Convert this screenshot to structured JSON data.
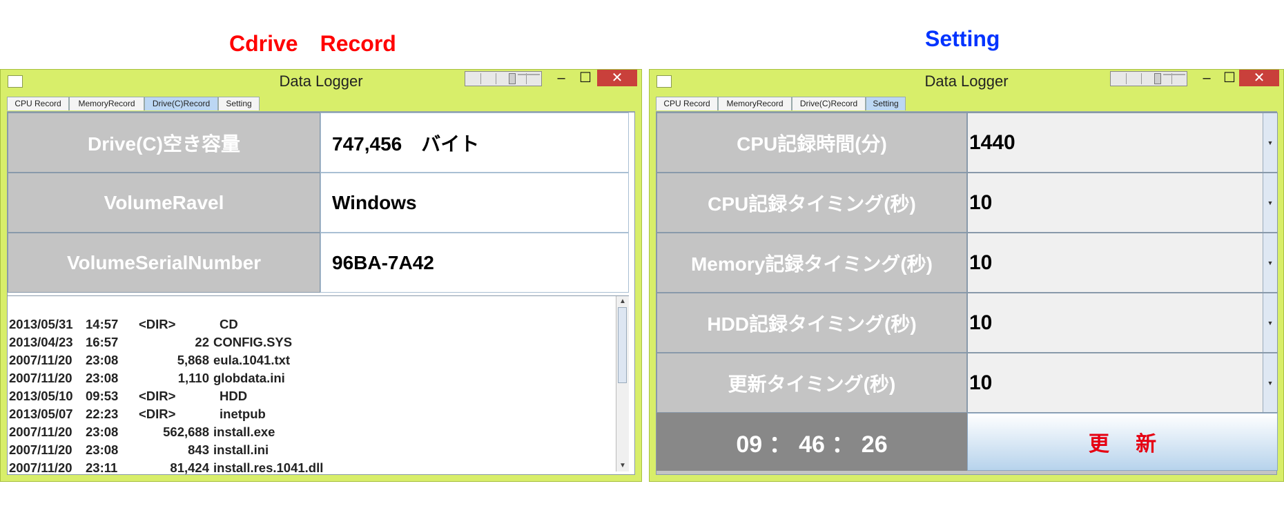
{
  "captions": {
    "left": "Cdrive　Record",
    "right": "Setting",
    "left_color": "#ff0000",
    "right_color": "#0033ff"
  },
  "window": {
    "title": "Data Logger",
    "minimize_label": "–",
    "maximize_label": "☐",
    "close_label": "✕"
  },
  "tabs": [
    "CPU Record",
    "MemoryRecord",
    "Drive(C)Record",
    "Setting"
  ],
  "drive": {
    "rows": [
      {
        "label": "Drive(C)空き容量",
        "value": "747,456　バイト"
      },
      {
        "label": "VolumeRavel",
        "value": "Windows"
      },
      {
        "label": "VolumeSerialNumber",
        "value": "96BA-7A42"
      }
    ],
    "dir_listing": [
      {
        "date": "2013/05/31",
        "time": "14:57",
        "size": "<DIR>",
        "name": "CD"
      },
      {
        "date": "2013/04/23",
        "time": "16:57",
        "size": "22",
        "name": "CONFIG.SYS"
      },
      {
        "date": "2007/11/20",
        "time": "23:08",
        "size": "5,868",
        "name": "eula.1041.txt"
      },
      {
        "date": "2007/11/20",
        "time": "23:08",
        "size": "1,110",
        "name": "globdata.ini"
      },
      {
        "date": "2013/05/10",
        "time": "09:53",
        "size": "<DIR>",
        "name": "HDD"
      },
      {
        "date": "2013/05/07",
        "time": "22:23",
        "size": "<DIR>",
        "name": "inetpub"
      },
      {
        "date": "2007/11/20",
        "time": "23:08",
        "size": "562,688",
        "name": "install.exe"
      },
      {
        "date": "2007/11/20",
        "time": "23:08",
        "size": "843",
        "name": "install.ini"
      },
      {
        "date": "2007/11/20",
        "time": "23:11",
        "size": "81,424",
        "name": "install.res.1041.dll"
      }
    ]
  },
  "settings": {
    "rows": [
      {
        "label": "CPU記録時間(分)",
        "value": "1440"
      },
      {
        "label": "CPU記録タイミング(秒)",
        "value": "10"
      },
      {
        "label": "Memory記録タイミング(秒)",
        "value": "10"
      },
      {
        "label": "HDD記録タイミング(秒)",
        "value": "10"
      },
      {
        "label": "更新タイミング(秒)",
        "value": "10"
      }
    ],
    "clock": "09 ： 46 ： 26",
    "update_label": "更　 新"
  }
}
